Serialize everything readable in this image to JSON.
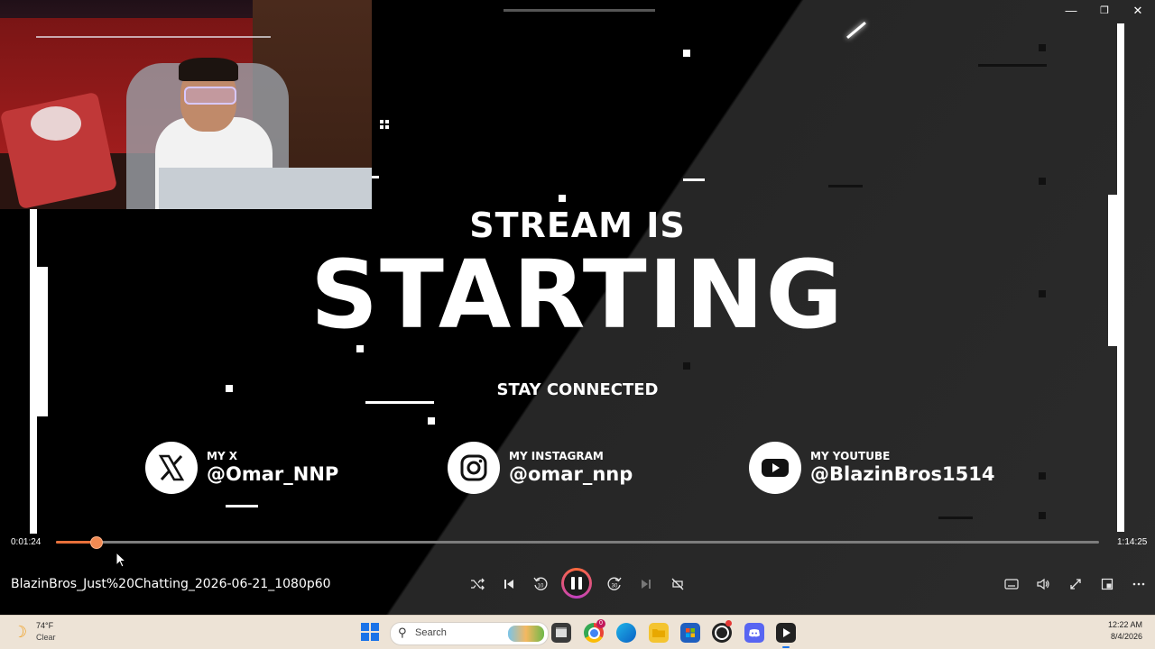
{
  "window": {
    "minimize_glyph": "—",
    "restore_glyph": "❐",
    "close_glyph": "✕"
  },
  "stream": {
    "headline_small": "STREAM IS",
    "headline_big": "STARTING",
    "stay_connected": "STAY CONNECTED",
    "socials": [
      {
        "caption": "MY X",
        "handle": "@Omar_NNP",
        "icon": "x-logo-icon"
      },
      {
        "caption": "MY INSTAGRAM",
        "handle": "@omar_nnp",
        "icon": "instagram-icon"
      },
      {
        "caption": "MY YOUTUBE",
        "handle": "@BlazinBros1514",
        "icon": "youtube-icon"
      }
    ]
  },
  "player": {
    "current_time": "0:01:24",
    "total_time": "1:14:25",
    "progress_fraction": 0.019,
    "title": "BlazinBros_Just%20Chatting_2026-06-21_1080p60",
    "controls": {
      "shuffle": "shuffle-icon",
      "previous": "previous-icon",
      "rewind": "rewind-10-icon",
      "play_pause": "pause-icon",
      "forward": "forward-30-icon",
      "next": "next-icon",
      "repeat": "repeat-off-icon",
      "captions": "captions-icon",
      "volume": "volume-icon",
      "fullscreen": "fullscreen-icon",
      "miniplayer": "miniplayer-icon",
      "more": "more-icon"
    },
    "accent_color": "#e8703a"
  },
  "taskbar": {
    "weather_temp": "74°F",
    "weather_condition": "Clear",
    "search_placeholder": "Search",
    "clock_time": "12:22 AM",
    "clock_date": "8/4/2026",
    "badge_count": "0"
  }
}
